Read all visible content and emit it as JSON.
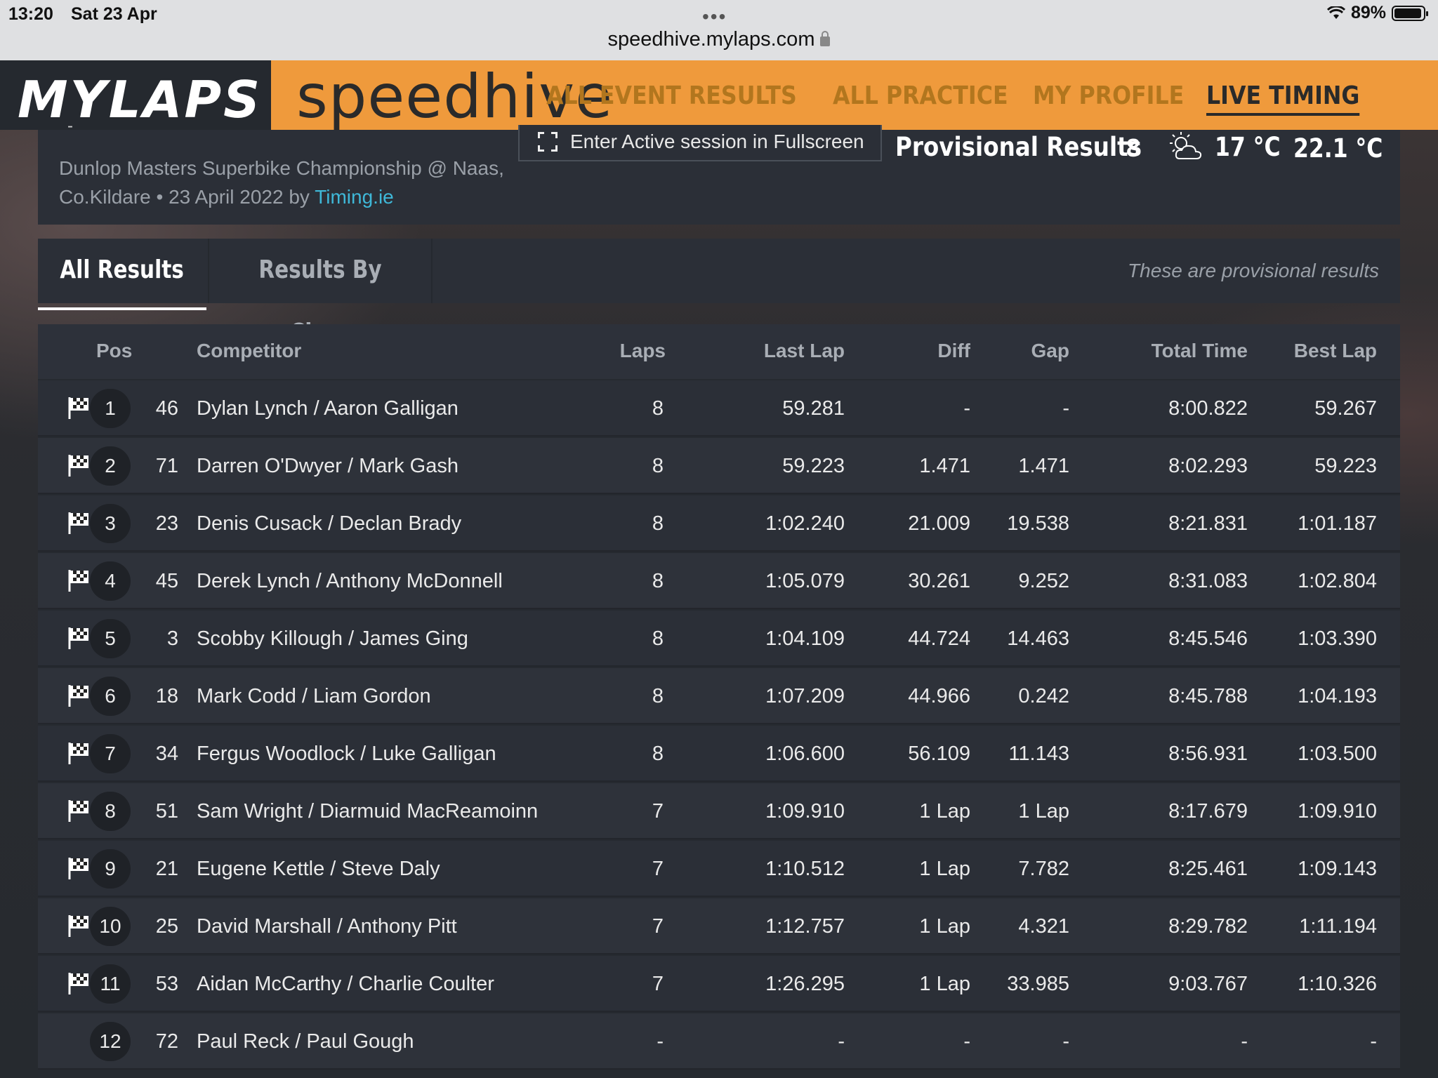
{
  "status_bar": {
    "time": "13:20",
    "date": "Sat 23 Apr",
    "battery": "89%",
    "url": "speedhive.mylaps.com"
  },
  "header": {
    "mylaps_logo": "MYLAPS",
    "speedhive_logo": "speedhive",
    "nav": [
      "ALL EVENT RESULTS",
      "ALL PRACTICE",
      "MY PROFILE",
      "LIVE TIMING"
    ],
    "active_nav": "LIVE TIMING"
  },
  "event": {
    "dash": "-",
    "title_line": "Dunlop Masters Superbike Championship @ Naas, Co.Kildare • 23 April 2022 by",
    "organizer_link": "Timing.ie",
    "fullscreen_label": "Enter Active session in Fullscreen",
    "results_status": "Provisional Results",
    "laps": "8",
    "air_temp": "17 °C",
    "track_temp": "22.1 °C"
  },
  "tabs": {
    "all_results": "All Results",
    "results_by_class": "Results By Class",
    "note": "These are provisional results"
  },
  "table": {
    "columns": {
      "pos": "Pos",
      "competitor": "Competitor",
      "laps": "Laps",
      "last_lap": "Last Lap",
      "diff": "Diff",
      "gap": "Gap",
      "total_time": "Total Time",
      "best_lap": "Best Lap"
    },
    "rows": [
      {
        "pos": "1",
        "num": "46",
        "name": "Dylan Lynch / Aaron Galligan",
        "laps": "8",
        "last": "59.281",
        "diff": "-",
        "gap": "-",
        "total": "8:00.822",
        "best": "59.267",
        "flag": true
      },
      {
        "pos": "2",
        "num": "71",
        "name": "Darren O'Dwyer / Mark Gash",
        "laps": "8",
        "last": "59.223",
        "diff": "1.471",
        "gap": "1.471",
        "total": "8:02.293",
        "best": "59.223",
        "flag": true
      },
      {
        "pos": "3",
        "num": "23",
        "name": "Denis Cusack / Declan Brady",
        "laps": "8",
        "last": "1:02.240",
        "diff": "21.009",
        "gap": "19.538",
        "total": "8:21.831",
        "best": "1:01.187",
        "flag": true
      },
      {
        "pos": "4",
        "num": "45",
        "name": "Derek Lynch / Anthony McDonnell",
        "laps": "8",
        "last": "1:05.079",
        "diff": "30.261",
        "gap": "9.252",
        "total": "8:31.083",
        "best": "1:02.804",
        "flag": true
      },
      {
        "pos": "5",
        "num": "3",
        "name": "Scobby Killough / James Ging",
        "laps": "8",
        "last": "1:04.109",
        "diff": "44.724",
        "gap": "14.463",
        "total": "8:45.546",
        "best": "1:03.390",
        "flag": true
      },
      {
        "pos": "6",
        "num": "18",
        "name": "Mark Codd / Liam Gordon",
        "laps": "8",
        "last": "1:07.209",
        "diff": "44.966",
        "gap": "0.242",
        "total": "8:45.788",
        "best": "1:04.193",
        "flag": true
      },
      {
        "pos": "7",
        "num": "34",
        "name": "Fergus Woodlock / Luke Galligan",
        "laps": "8",
        "last": "1:06.600",
        "diff": "56.109",
        "gap": "11.143",
        "total": "8:56.931",
        "best": "1:03.500",
        "flag": true
      },
      {
        "pos": "8",
        "num": "51",
        "name": "Sam Wright / Diarmuid MacReamoinn",
        "laps": "7",
        "last": "1:09.910",
        "diff": "1 Lap",
        "gap": "1 Lap",
        "total": "8:17.679",
        "best": "1:09.910",
        "flag": true
      },
      {
        "pos": "9",
        "num": "21",
        "name": "Eugene Kettle / Steve Daly",
        "laps": "7",
        "last": "1:10.512",
        "diff": "1 Lap",
        "gap": "7.782",
        "total": "8:25.461",
        "best": "1:09.143",
        "flag": true
      },
      {
        "pos": "10",
        "num": "25",
        "name": "David Marshall / Anthony Pitt",
        "laps": "7",
        "last": "1:12.757",
        "diff": "1 Lap",
        "gap": "4.321",
        "total": "8:29.782",
        "best": "1:11.194",
        "flag": true
      },
      {
        "pos": "11",
        "num": "53",
        "name": "Aidan McCarthy / Charlie Coulter",
        "laps": "7",
        "last": "1:26.295",
        "diff": "1 Lap",
        "gap": "33.985",
        "total": "9:03.767",
        "best": "1:10.326",
        "flag": true
      },
      {
        "pos": "12",
        "num": "72",
        "name": "Paul Reck / Paul Gough",
        "laps": "-",
        "last": "-",
        "diff": "-",
        "gap": "-",
        "total": "-",
        "best": "-",
        "flag": false
      }
    ]
  }
}
